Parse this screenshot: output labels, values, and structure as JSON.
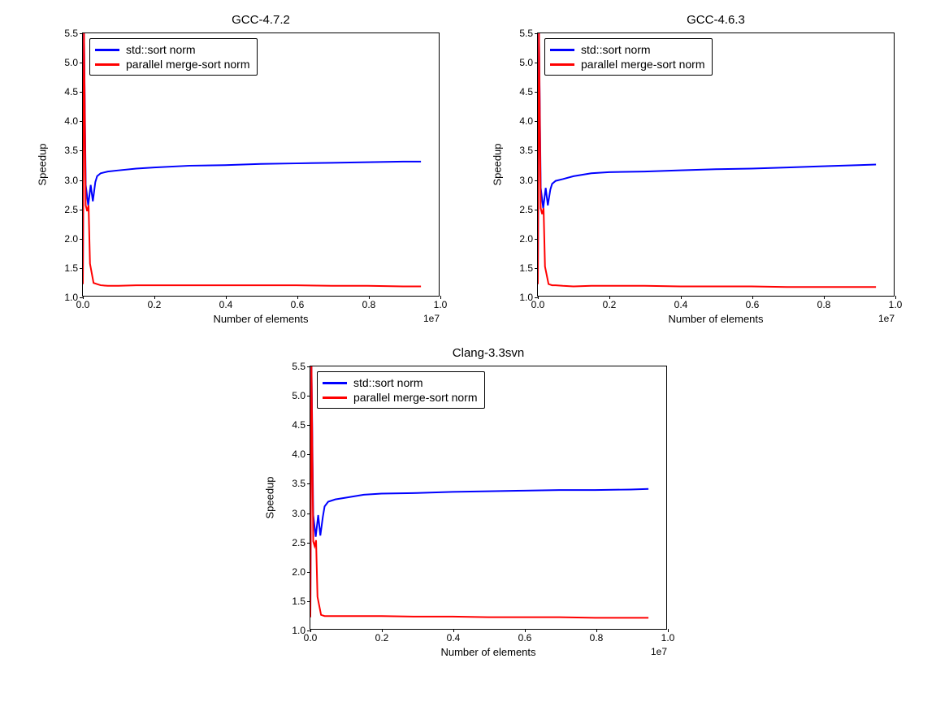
{
  "chart_data": [
    {
      "type": "line",
      "title": "GCC-4.7.2",
      "xlabel": "Number of elements",
      "ylabel": "Speedup",
      "xlim": [
        0,
        1.0
      ],
      "ylim": [
        1.0,
        5.5
      ],
      "xticks": [
        0.0,
        0.2,
        0.4,
        0.6,
        0.8,
        1.0
      ],
      "yticks": [
        1.0,
        1.5,
        2.0,
        2.5,
        3.0,
        3.5,
        4.0,
        4.5,
        5.0,
        5.5
      ],
      "x_exponent": "1e7",
      "series": [
        {
          "name": "std::sort norm",
          "color": "#0000ff",
          "x": [
            0.0,
            0.003,
            0.008,
            0.015,
            0.022,
            0.028,
            0.035,
            0.04,
            0.05,
            0.07,
            0.1,
            0.15,
            0.2,
            0.3,
            0.4,
            0.5,
            0.6,
            0.7,
            0.8,
            0.9,
            0.95
          ],
          "values": [
            1.2,
            5.6,
            2.9,
            2.55,
            2.9,
            2.62,
            2.95,
            3.05,
            3.1,
            3.13,
            3.15,
            3.18,
            3.2,
            3.23,
            3.24,
            3.26,
            3.27,
            3.28,
            3.29,
            3.3,
            3.3
          ]
        },
        {
          "name": "parallel merge-sort norm",
          "color": "#ff0000",
          "x": [
            0.0,
            0.003,
            0.008,
            0.012,
            0.016,
            0.02,
            0.03,
            0.04,
            0.05,
            0.07,
            0.1,
            0.15,
            0.2,
            0.3,
            0.4,
            0.5,
            0.6,
            0.7,
            0.8,
            0.9,
            0.95
          ],
          "values": [
            1.2,
            5.6,
            2.55,
            2.45,
            2.55,
            1.55,
            1.22,
            1.2,
            1.18,
            1.17,
            1.17,
            1.18,
            1.18,
            1.18,
            1.18,
            1.18,
            1.18,
            1.17,
            1.17,
            1.16,
            1.16
          ]
        }
      ]
    },
    {
      "type": "line",
      "title": "GCC-4.6.3",
      "xlabel": "Number of elements",
      "ylabel": "Speedup",
      "xlim": [
        0,
        1.0
      ],
      "ylim": [
        1.0,
        5.5
      ],
      "xticks": [
        0.0,
        0.2,
        0.4,
        0.6,
        0.8,
        1.0
      ],
      "yticks": [
        1.0,
        1.5,
        2.0,
        2.5,
        3.0,
        3.5,
        4.0,
        4.5,
        5.0,
        5.5
      ],
      "x_exponent": "1e7",
      "series": [
        {
          "name": "std::sort norm",
          "color": "#0000ff",
          "x": [
            0.0,
            0.003,
            0.008,
            0.015,
            0.022,
            0.028,
            0.035,
            0.04,
            0.05,
            0.07,
            0.1,
            0.15,
            0.2,
            0.3,
            0.4,
            0.5,
            0.6,
            0.7,
            0.8,
            0.9,
            0.95
          ],
          "values": [
            1.2,
            5.6,
            2.85,
            2.5,
            2.85,
            2.55,
            2.82,
            2.92,
            2.97,
            3.0,
            3.05,
            3.1,
            3.12,
            3.13,
            3.15,
            3.17,
            3.18,
            3.2,
            3.22,
            3.24,
            3.25
          ]
        },
        {
          "name": "parallel merge-sort norm",
          "color": "#ff0000",
          "x": [
            0.0,
            0.003,
            0.008,
            0.012,
            0.016,
            0.02,
            0.03,
            0.04,
            0.05,
            0.07,
            0.1,
            0.15,
            0.2,
            0.3,
            0.4,
            0.5,
            0.6,
            0.7,
            0.8,
            0.9,
            0.95
          ],
          "values": [
            1.2,
            5.6,
            2.5,
            2.4,
            2.5,
            1.5,
            1.2,
            1.18,
            1.18,
            1.17,
            1.16,
            1.17,
            1.17,
            1.17,
            1.16,
            1.16,
            1.16,
            1.15,
            1.15,
            1.15,
            1.15
          ]
        }
      ]
    },
    {
      "type": "line",
      "title": "Clang-3.3svn",
      "xlabel": "Number of elements",
      "ylabel": "Speedup",
      "xlim": [
        0,
        1.0
      ],
      "ylim": [
        1.0,
        5.5
      ],
      "xticks": [
        0.0,
        0.2,
        0.4,
        0.6,
        0.8,
        1.0
      ],
      "yticks": [
        1.0,
        1.5,
        2.0,
        2.5,
        3.0,
        3.5,
        4.0,
        4.5,
        5.0,
        5.5
      ],
      "x_exponent": "1e7",
      "series": [
        {
          "name": "std::sort norm",
          "color": "#0000ff",
          "x": [
            0.0,
            0.003,
            0.008,
            0.015,
            0.022,
            0.028,
            0.035,
            0.04,
            0.05,
            0.07,
            0.1,
            0.15,
            0.2,
            0.3,
            0.4,
            0.5,
            0.6,
            0.7,
            0.8,
            0.9,
            0.95
          ],
          "values": [
            1.2,
            5.6,
            2.95,
            2.58,
            2.95,
            2.6,
            2.92,
            3.1,
            3.18,
            3.22,
            3.25,
            3.3,
            3.32,
            3.33,
            3.35,
            3.36,
            3.37,
            3.38,
            3.38,
            3.39,
            3.4
          ]
        },
        {
          "name": "parallel merge-sort norm",
          "color": "#ff0000",
          "x": [
            0.0,
            0.003,
            0.008,
            0.012,
            0.016,
            0.02,
            0.03,
            0.04,
            0.05,
            0.07,
            0.1,
            0.15,
            0.2,
            0.3,
            0.4,
            0.5,
            0.6,
            0.7,
            0.8,
            0.9,
            0.95
          ],
          "values": [
            1.2,
            5.6,
            2.5,
            2.42,
            2.52,
            1.55,
            1.24,
            1.22,
            1.22,
            1.22,
            1.22,
            1.22,
            1.22,
            1.21,
            1.21,
            1.2,
            1.2,
            1.2,
            1.19,
            1.19,
            1.19
          ]
        }
      ]
    }
  ]
}
